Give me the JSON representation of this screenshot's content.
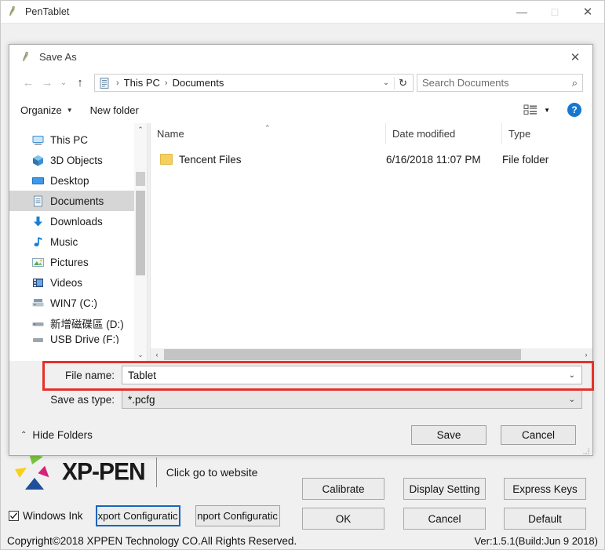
{
  "app": {
    "title": "PenTablet",
    "icon": "pentablet-icon",
    "window_buttons": {
      "minimize": "—",
      "maximize": "□",
      "close": "✕"
    }
  },
  "dialog": {
    "title": "Save As",
    "icon": "pentablet-icon",
    "close": "✕",
    "nav": {
      "back": "←",
      "forward": "→",
      "recent": "⌄",
      "up": "↑"
    },
    "address": {
      "icon": "documents-folder-icon",
      "crumbs": [
        "This PC",
        "Documents"
      ],
      "separator": "›",
      "dropdown": "⌄",
      "refresh": "↻"
    },
    "search": {
      "placeholder": "Search Documents",
      "icon": "⌕"
    },
    "commands": {
      "organize": "Organize",
      "new_folder": "New folder",
      "caret": "▼",
      "view_icon": "list-view-icon",
      "view_caret": "▼",
      "help": "?"
    },
    "sidebar": {
      "items": [
        {
          "label": "This PC",
          "icon": "this-pc-icon"
        },
        {
          "label": "3D Objects",
          "icon": "3d-objects-icon"
        },
        {
          "label": "Desktop",
          "icon": "desktop-icon"
        },
        {
          "label": "Documents",
          "icon": "documents-icon",
          "selected": true
        },
        {
          "label": "Downloads",
          "icon": "downloads-icon"
        },
        {
          "label": "Music",
          "icon": "music-icon"
        },
        {
          "label": "Pictures",
          "icon": "pictures-icon"
        },
        {
          "label": "Videos",
          "icon": "videos-icon"
        },
        {
          "label": "WIN7 (C:)",
          "icon": "local-disk-icon"
        },
        {
          "label": "新增磁碟區 (D:)",
          "icon": "local-disk-icon"
        },
        {
          "label": "USB Drive (F:)",
          "icon": "usb-drive-icon"
        }
      ],
      "scroll_up": "⌃",
      "scroll_down": "⌄"
    },
    "filelist": {
      "columns": [
        "Name",
        "Date modified",
        "Type"
      ],
      "sort_caret": "⌃",
      "rows": [
        {
          "name": "Tencent Files",
          "date": "6/16/2018 11:07 PM",
          "type": "File folder",
          "icon": "folder-icon"
        }
      ],
      "hscroll_left": "‹",
      "hscroll_right": "›"
    },
    "fields": {
      "filename_label": "File name:",
      "filename_value": "Tablet",
      "savetype_label": "Save as type:",
      "savetype_value": "*.pcfg",
      "caret": "⌄"
    },
    "footer": {
      "hide_folders": "Hide Folders",
      "hide_caret": "⌃",
      "save": "Save",
      "cancel": "Cancel"
    },
    "highlight_color": "#e8302a"
  },
  "branding": {
    "wordmark": "XP-PEN",
    "website_text": "Click go to website",
    "logo_colors": {
      "green": "#7ac143",
      "yellow": "#f7d117",
      "magenta": "#d6227a",
      "blue": "#1f4e9c"
    }
  },
  "footer": {
    "windows_ink": "Windows Ink",
    "windows_ink_checked": true,
    "export_config": "xport Configuratic",
    "import_config": "nport Configuratic",
    "copyright": "Copyright©2018  XPPEN  Technology CO.All Rights Reserved.",
    "version": "Ver:1.5.1(Build:Jun  9 2018)"
  },
  "buttons": {
    "calibrate": "Calibrate",
    "display_setting": "Display Setting",
    "express_keys": "Express Keys",
    "ok": "OK",
    "cancel": "Cancel",
    "default": "Default"
  }
}
